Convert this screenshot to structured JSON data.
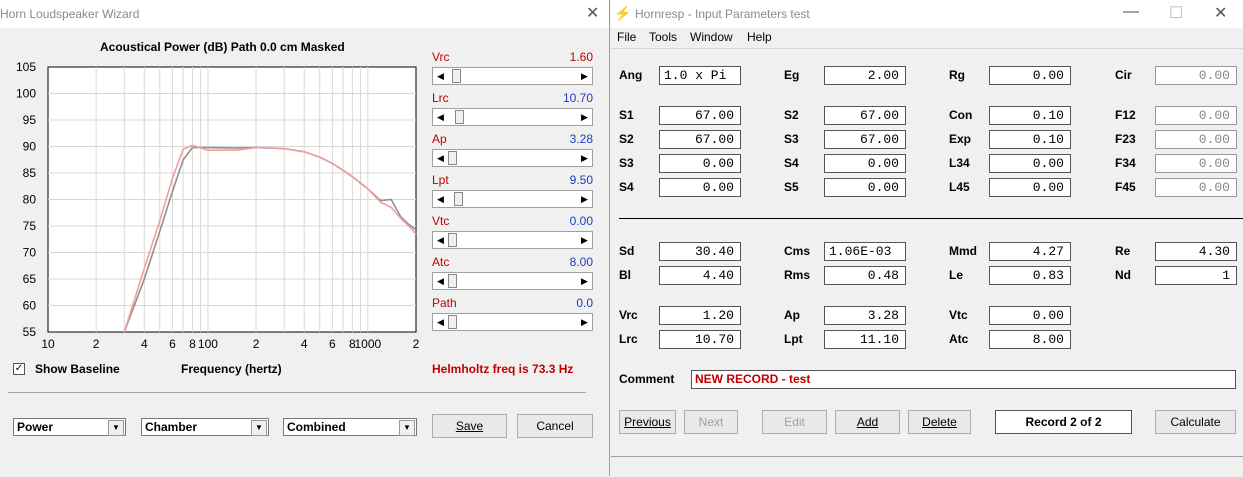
{
  "wizard": {
    "title": "Horn Loudspeaker Wizard",
    "chart_title": "Acoustical Power (dB)   Path 0.0 cm   Masked",
    "sliders": [
      {
        "label": "Vrc",
        "value": "1.60",
        "color": "red",
        "position": 0.03
      },
      {
        "label": "Lrc",
        "value": "10.70",
        "color": "blue",
        "position": 0.06
      },
      {
        "label": "Ap",
        "value": "3.28",
        "color": "blue",
        "position": 0.0
      },
      {
        "label": "Lpt",
        "value": "9.50",
        "color": "blue",
        "position": 0.05
      },
      {
        "label": "Vtc",
        "value": "0.00",
        "color": "blue",
        "position": 0.0
      },
      {
        "label": "Atc",
        "value": "8.00",
        "color": "blue",
        "position": 0.0
      },
      {
        "label": "Path",
        "value": "0.0",
        "color": "blue",
        "position": 0.0
      }
    ],
    "show_baseline": "Show Baseline",
    "show_baseline_checked": "✓",
    "frequency_label": "Frequency (hertz)",
    "helmholtz": "Helmholtz freq is 73.3 Hz",
    "combos": {
      "power": "Power",
      "chamber": "Chamber",
      "combined": "Combined"
    },
    "save": "Save",
    "cancel": "Cancel"
  },
  "chart_data": {
    "type": "line",
    "title": "Acoustical Power (dB)   Path 0.0 cm   Masked",
    "xlabel": "Frequency (hertz)",
    "ylabel": "",
    "x_scale": "log",
    "xlim": [
      10,
      2000
    ],
    "ylim": [
      55,
      105
    ],
    "grid": true,
    "yticks": [
      105,
      100,
      95,
      90,
      85,
      80,
      75,
      70,
      65,
      60,
      55
    ],
    "xtick_labels": [
      {
        "value": 10,
        "label": "10"
      },
      {
        "value": 20,
        "label": "2"
      },
      {
        "value": 40,
        "label": "4"
      },
      {
        "value": 60,
        "label": "6"
      },
      {
        "value": 80,
        "label": "8"
      },
      {
        "value": 100,
        "label": "100"
      },
      {
        "value": 200,
        "label": "2"
      },
      {
        "value": 400,
        "label": "4"
      },
      {
        "value": 600,
        "label": "6"
      },
      {
        "value": 800,
        "label": "8"
      },
      {
        "value": 1000,
        "label": "1000"
      },
      {
        "value": 2000,
        "label": "2"
      }
    ],
    "series": [
      {
        "color": "#909090",
        "x": [
          30,
          40,
          50,
          60,
          70,
          80,
          100,
          150,
          200,
          300,
          400,
          500,
          600,
          700,
          800,
          1000,
          1200,
          1400,
          1600,
          1800,
          2000
        ],
        "y": [
          55,
          65,
          74,
          81.5,
          87.5,
          89.8,
          89.8,
          89.7,
          89.8,
          89.6,
          89.0,
          88.0,
          86.8,
          85.5,
          84.3,
          82.0,
          79.8,
          80.0,
          76.8,
          75.3,
          74.3
        ]
      },
      {
        "color": "#f0a0a0",
        "x": [
          30,
          40,
          50,
          60,
          70,
          80,
          100,
          150,
          200,
          300,
          400,
          500,
          600,
          700,
          800,
          1000,
          1200,
          1400,
          1600,
          1800,
          2000
        ],
        "y": [
          55,
          67,
          76,
          84,
          89.5,
          90.2,
          89.3,
          89.3,
          89.8,
          89.6,
          89.0,
          88.0,
          86.8,
          85.5,
          84.3,
          82.0,
          79.5,
          78.5,
          76.5,
          75.0,
          73.5
        ]
      }
    ]
  },
  "hornresp": {
    "title": "Hornresp - Input Parameters   test",
    "menu": [
      "File",
      "Tools",
      "Window",
      "Help"
    ],
    "params_top": [
      {
        "label": "Ang",
        "value": "1.0 x Pi",
        "col": 0,
        "row": 0,
        "left": true
      },
      {
        "label": "Eg",
        "value": "2.00",
        "col": 1,
        "row": 0
      },
      {
        "label": "Rg",
        "value": "0.00",
        "col": 2,
        "row": 0
      },
      {
        "label": "Cir",
        "value": "0.00",
        "col": 3,
        "row": 0,
        "gray": true
      },
      {
        "label": "S1",
        "value": "67.00",
        "col": 0,
        "row": 1
      },
      {
        "label": "S2",
        "value": "67.00",
        "col": 1,
        "row": 1
      },
      {
        "label": "Con",
        "value": "0.10",
        "col": 2,
        "row": 1
      },
      {
        "label": "F12",
        "value": "0.00",
        "col": 3,
        "row": 1,
        "gray": true
      },
      {
        "label": "S2",
        "value": "67.00",
        "col": 0,
        "row": 2
      },
      {
        "label": "S3",
        "value": "67.00",
        "col": 1,
        "row": 2
      },
      {
        "label": "Exp",
        "value": "0.10",
        "col": 2,
        "row": 2
      },
      {
        "label": "F23",
        "value": "0.00",
        "col": 3,
        "row": 2,
        "gray": true
      },
      {
        "label": "S3",
        "value": "0.00",
        "col": 0,
        "row": 3
      },
      {
        "label": "S4",
        "value": "0.00",
        "col": 1,
        "row": 3
      },
      {
        "label": "L34",
        "value": "0.00",
        "col": 2,
        "row": 3
      },
      {
        "label": "F34",
        "value": "0.00",
        "col": 3,
        "row": 3,
        "gray": true
      },
      {
        "label": "S4",
        "value": "0.00",
        "col": 0,
        "row": 4
      },
      {
        "label": "S5",
        "value": "0.00",
        "col": 1,
        "row": 4
      },
      {
        "label": "L45",
        "value": "0.00",
        "col": 2,
        "row": 4
      },
      {
        "label": "F45",
        "value": "0.00",
        "col": 3,
        "row": 4,
        "gray": true
      }
    ],
    "params_driver": [
      {
        "label": "Sd",
        "value": "30.40",
        "col": 0,
        "row": 0
      },
      {
        "label": "Cms",
        "value": "1.06E-03",
        "col": 1,
        "row": 0,
        "left": true
      },
      {
        "label": "Mmd",
        "value": "4.27",
        "col": 2,
        "row": 0
      },
      {
        "label": "Re",
        "value": "4.30",
        "col": 3,
        "row": 0
      },
      {
        "label": "Bl",
        "value": "4.40",
        "col": 0,
        "row": 1
      },
      {
        "label": "Rms",
        "value": "0.48",
        "col": 1,
        "row": 1
      },
      {
        "label": "Le",
        "value": "0.83",
        "col": 2,
        "row": 1
      },
      {
        "label": "Nd",
        "value": "1",
        "col": 3,
        "row": 1
      }
    ],
    "params_chamber": [
      {
        "label": "Vrc",
        "value": "1.20",
        "col": 0,
        "row": 0
      },
      {
        "label": "Ap",
        "value": "3.28",
        "col": 1,
        "row": 0
      },
      {
        "label": "Vtc",
        "value": "0.00",
        "col": 2,
        "row": 0
      },
      {
        "label": "Lrc",
        "value": "10.70",
        "col": 0,
        "row": 1
      },
      {
        "label": "Lpt",
        "value": "11.10",
        "col": 1,
        "row": 1
      },
      {
        "label": "Atc",
        "value": "8.00",
        "col": 2,
        "row": 1
      }
    ],
    "comment_label": "Comment",
    "comment": "NEW RECORD - test",
    "buttons": {
      "previous": "Previous",
      "next": "Next",
      "edit": "Edit",
      "add": "Add",
      "delete": "Delete",
      "calculate": "Calculate"
    },
    "record": "Record 2 of 2"
  }
}
